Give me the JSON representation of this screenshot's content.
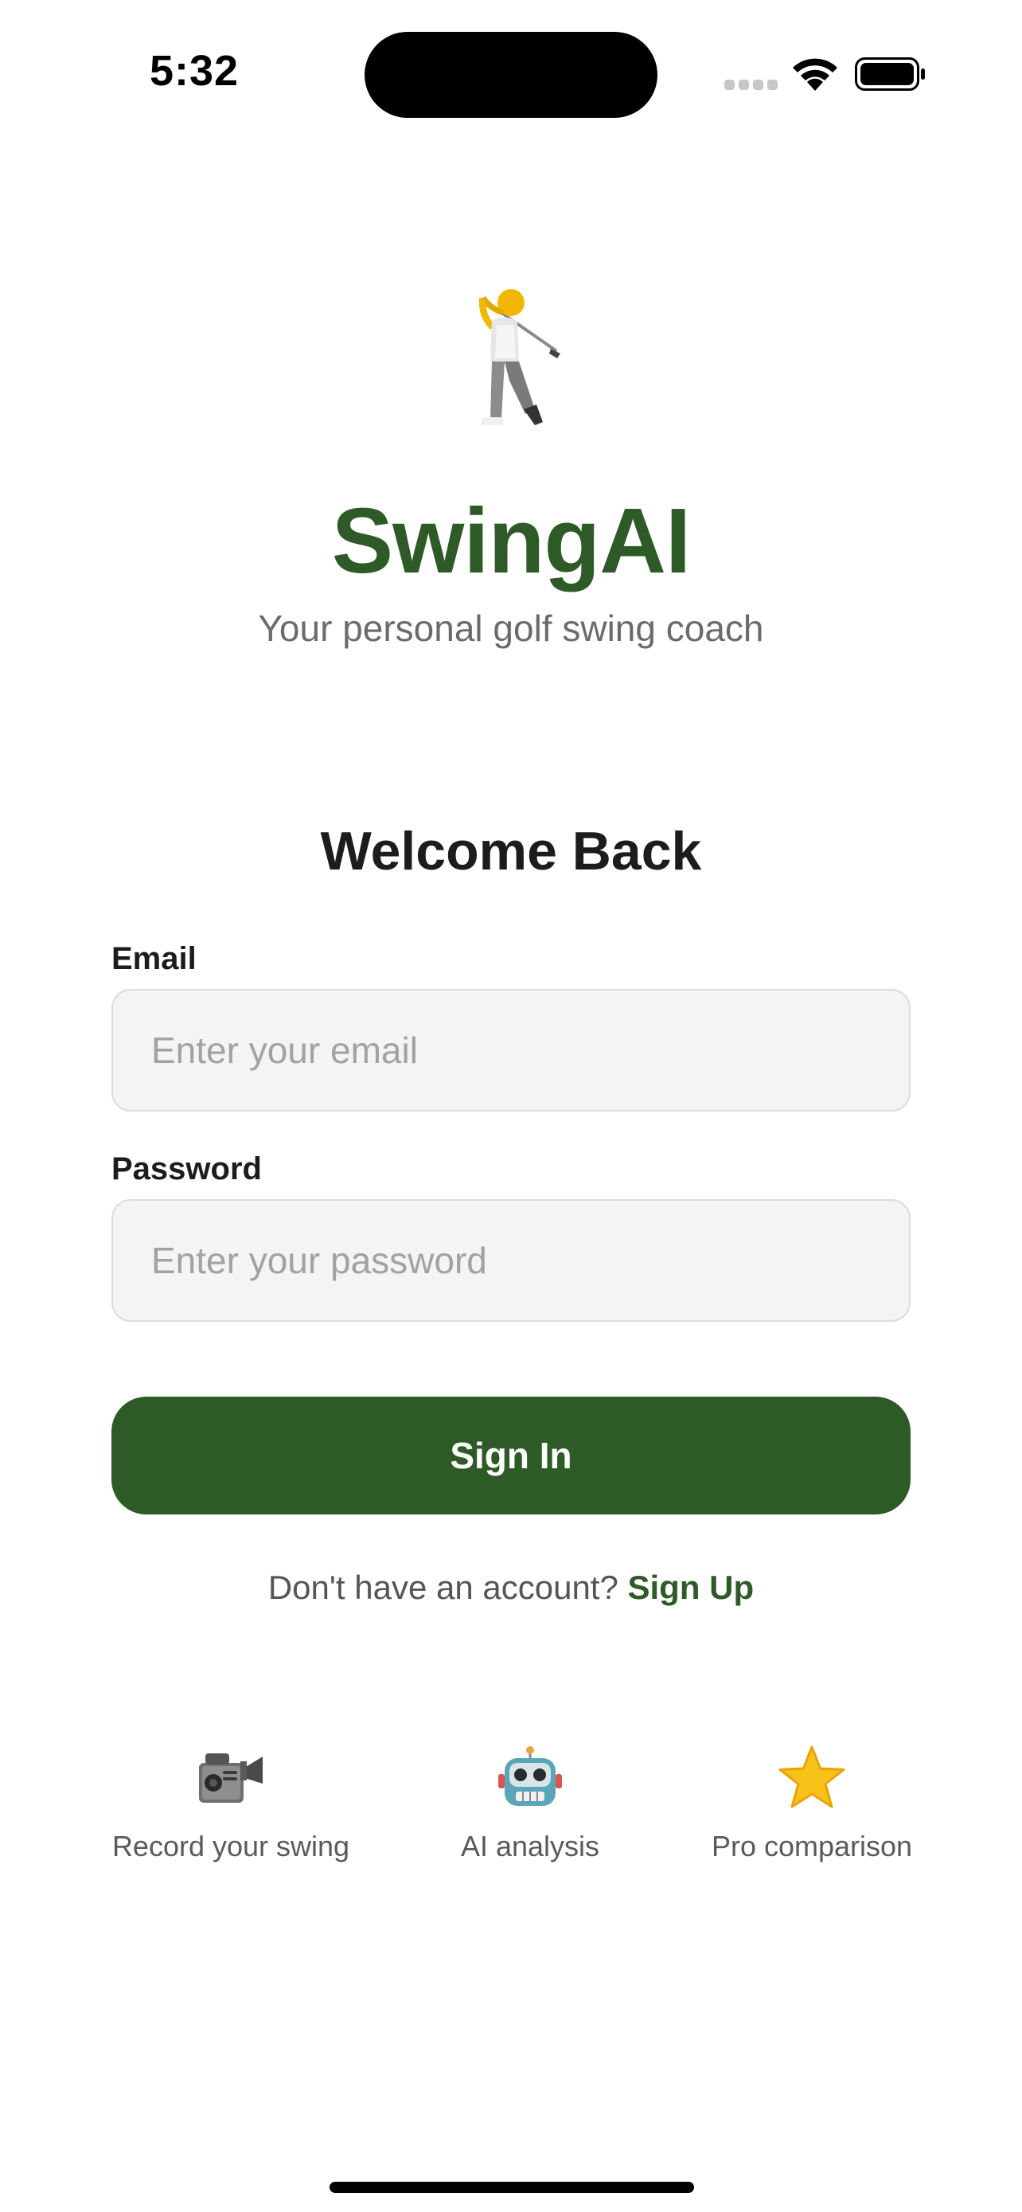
{
  "status_bar": {
    "time": "5:32"
  },
  "app": {
    "name": "SwingAI",
    "tagline": "Your personal golf swing coach",
    "brand_color": "#2e5a27",
    "logo_icon": "golfer-icon"
  },
  "login": {
    "title": "Welcome Back",
    "email_label": "Email",
    "email_placeholder": "Enter your email",
    "password_label": "Password",
    "password_placeholder": "Enter your password",
    "submit_label": "Sign In",
    "signup_prompt": "Don't have an account?",
    "signup_link": "Sign Up"
  },
  "features": [
    {
      "icon": "video-camera-icon",
      "label": "Record your swing"
    },
    {
      "icon": "robot-icon",
      "label": "AI analysis"
    },
    {
      "icon": "star-icon",
      "label": "Pro comparison"
    }
  ]
}
